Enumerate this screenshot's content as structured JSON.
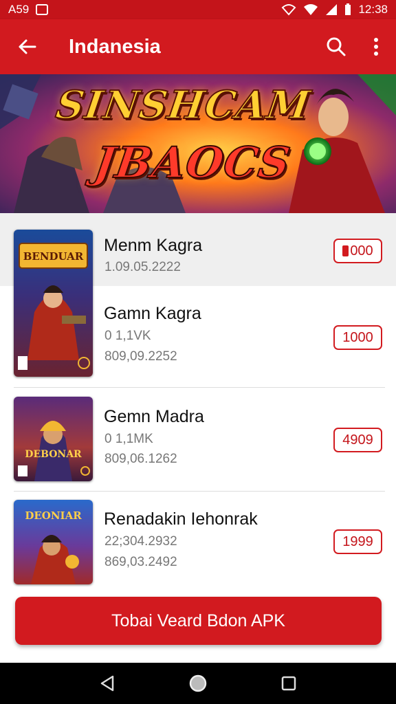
{
  "status_bar": {
    "left_text": "A59",
    "time": "12:38"
  },
  "app_bar": {
    "title": "Indanesia",
    "back_icon": "arrow-left-icon",
    "search_icon": "search-icon",
    "menu_icon": "more-vert-icon"
  },
  "banner": {
    "line1": "SINSHCAM",
    "line2": "JBAOCS"
  },
  "games": [
    {
      "name": "Menm Kagra",
      "meta1": "1.09.05.2222",
      "meta2": "",
      "price": "000",
      "thumb_text": "BENDUAR"
    },
    {
      "name": "Gamn Kagra",
      "meta1": "0 1,1VK",
      "meta2": "809,09.2252",
      "price": "1000",
      "thumb_text": ""
    },
    {
      "name": "Gemn Madra",
      "meta1": "0 1,1MK",
      "meta2": "809,06.1262",
      "price": "4909",
      "thumb_text": "DEBONAR"
    },
    {
      "name": "Renadakin Iehonrak",
      "meta1": "22;304.2932",
      "meta2": "869,03.2492",
      "price": "1999",
      "thumb_text": "DEONIAR"
    }
  ],
  "cta": {
    "label": "Tobai Veard Bdon APK"
  },
  "colors": {
    "primary": "#d21a1f",
    "primary_dark": "#c4141a"
  }
}
